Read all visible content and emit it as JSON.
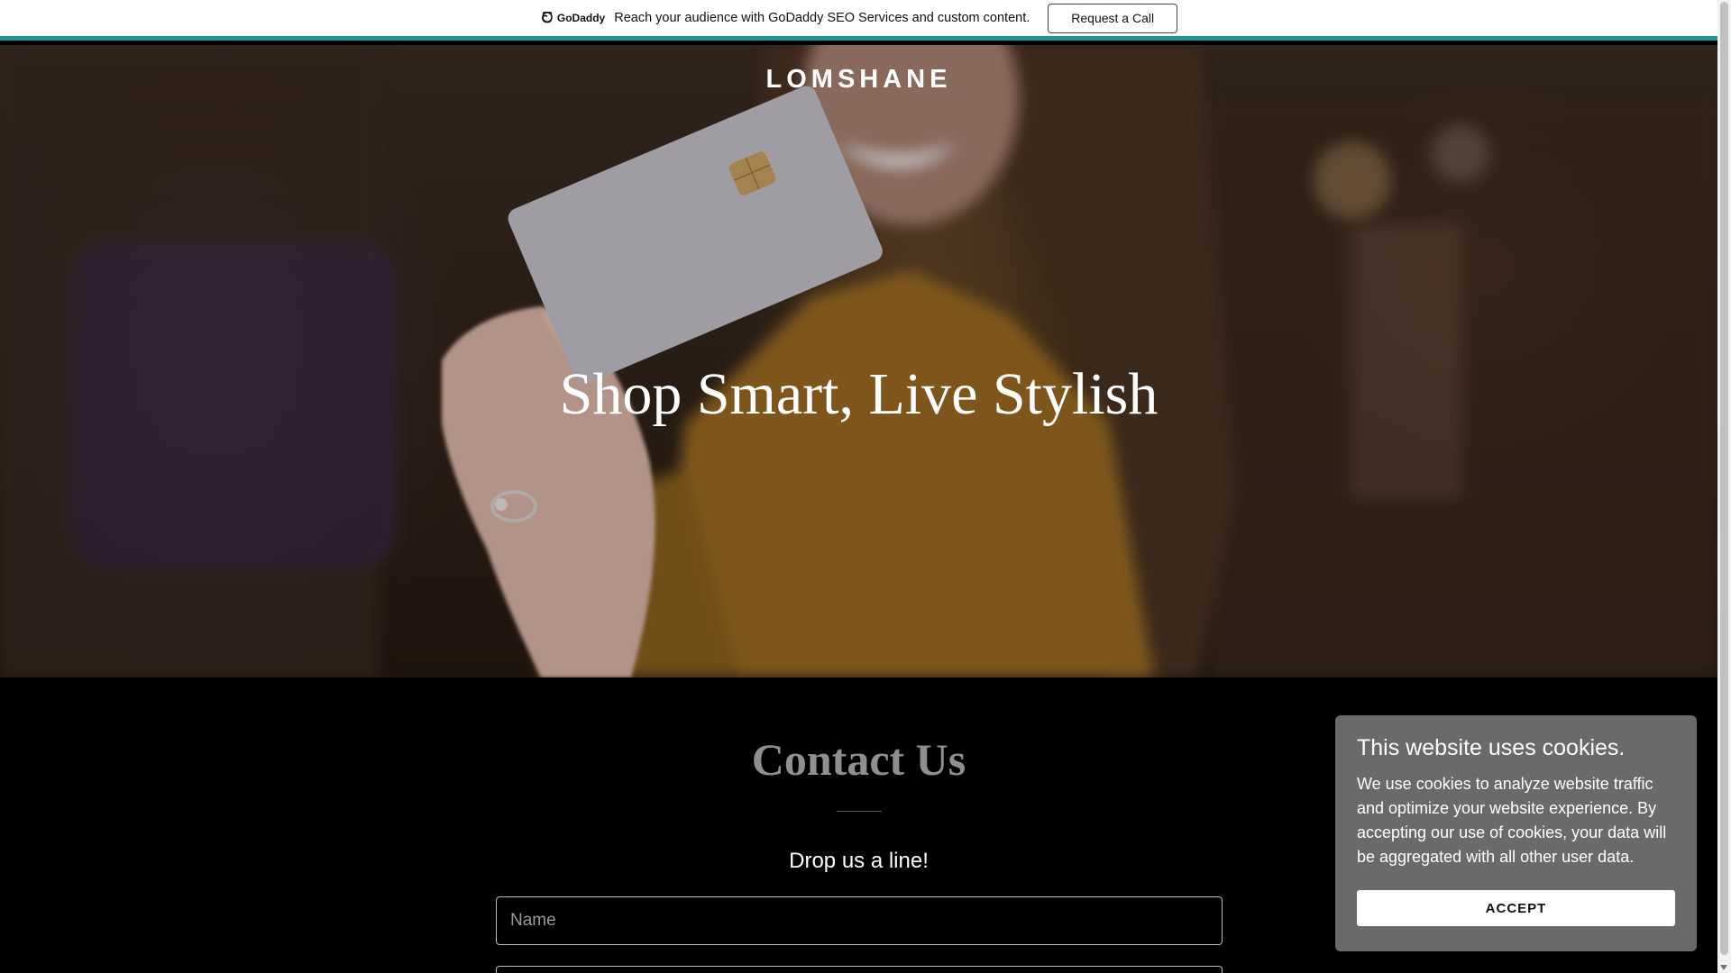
{
  "promo": {
    "logo_text": "GoDaddy",
    "message": "Reach your audience with GoDaddy SEO Services and custom content.",
    "button_label": "Request a Call"
  },
  "hero": {
    "brand": "LOMSHANE",
    "title": "Shop Smart, Live Stylish"
  },
  "contact": {
    "title": "Contact Us",
    "subtitle": "Drop us a line!",
    "name_placeholder": "Name",
    "email_placeholder": ""
  },
  "cookie": {
    "title": "This website uses cookies.",
    "text": "We use cookies to analyze website traffic and optimize your website experience. By accepting our use of cookies, your data will be aggregated with all other user data.",
    "accept_label": "ACCEPT"
  },
  "colors": {
    "promo_accent": "#1a9b94",
    "cookie_bg": "#6a6a6a",
    "page_bg": "#000000"
  }
}
